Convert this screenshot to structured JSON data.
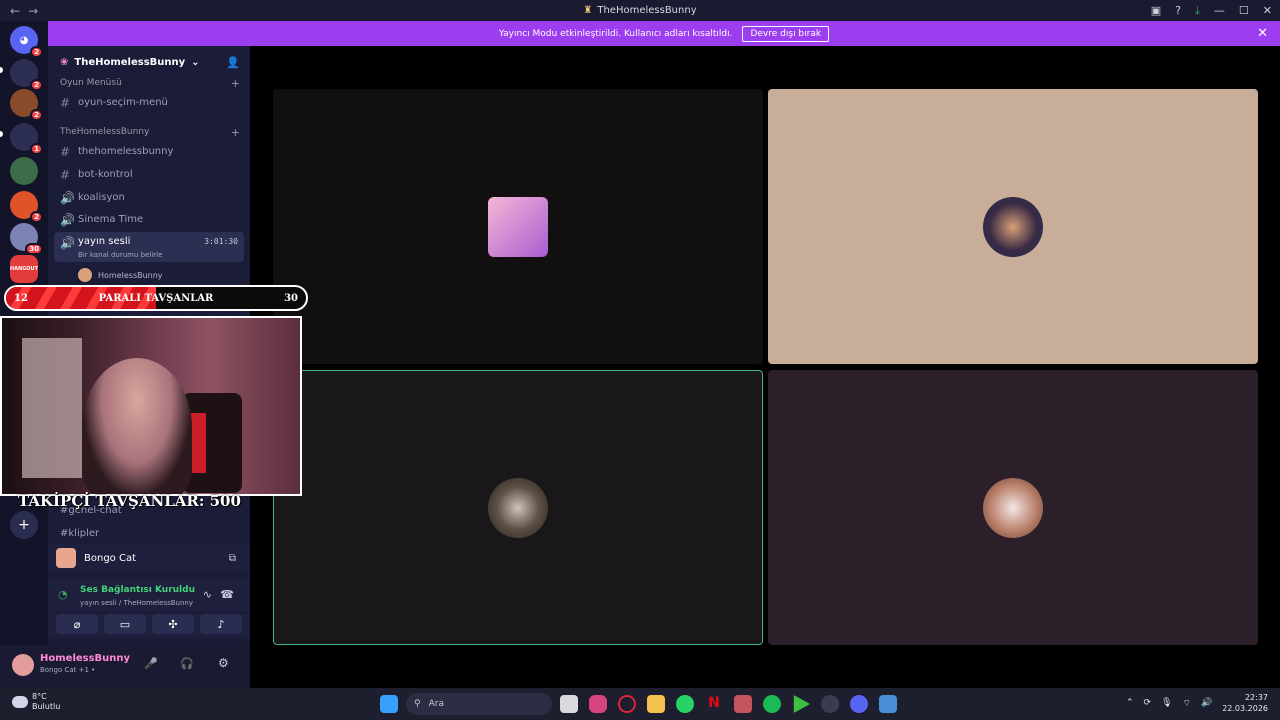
{
  "window": {
    "title": "TheHomelessBunny"
  },
  "banner": {
    "text": "Yayıncı Modu etkinleştirildi. Kullanıcı adları kısaltıldı.",
    "button": "Devre dışı bırak"
  },
  "servers": {
    "badges": [
      "2",
      "2",
      "2",
      "1",
      "2",
      "30"
    ],
    "hangout_label": "HANGOUT"
  },
  "sidebar": {
    "guild_name": "TheHomelessBunny",
    "categories": [
      {
        "label": "Oyun Menüsü"
      },
      {
        "label": "TheHomelessBunny"
      }
    ],
    "channels": [
      {
        "label": "oyun-seçim-menü"
      },
      {
        "label": "thehomelessbunny"
      },
      {
        "label": "bot-kontrol"
      },
      {
        "label": "koalisyon"
      },
      {
        "label": "Sinema Time"
      },
      {
        "label": "yayın sesli",
        "time": "3:01:30",
        "status": "Bir kanal durumu belirle"
      }
    ],
    "voice_user": "HomelessBunny",
    "lower_channels": [
      {
        "label": "genel-chat"
      },
      {
        "label": "klipler"
      }
    ]
  },
  "activity": {
    "name": "Bongo Cat"
  },
  "voice_connection": {
    "status": "Ses Bağlantısı Kuruldu",
    "location": "yayın sesli / TheHomelessBunny"
  },
  "user": {
    "name": "HomelessBunny",
    "status": "Bongo Cat +1 •"
  },
  "overlay": {
    "left_count": "12",
    "title": "PARALI TAVŞANLAR",
    "right_count": "30",
    "follower_text": "TAKİPÇİ TAVŞANLAR: 500"
  },
  "taskbar": {
    "weather_temp": "8°C",
    "weather_desc": "Bulutlu",
    "search_placeholder": "Ara",
    "time": "22:37",
    "date": "22.03.2026"
  },
  "colors": {
    "banner": "#9c3ef0",
    "speaking_border": "#43b581",
    "tile_dark": "#110f10",
    "tile_beige": "#c8ad98",
    "tile_plum": "#2b1f29"
  }
}
